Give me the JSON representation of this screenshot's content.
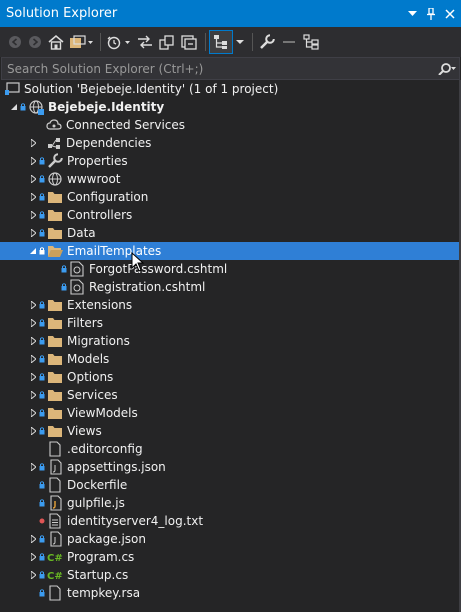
{
  "window": {
    "title": "Solution Explorer",
    "pin_icon": "pin-icon",
    "close_icon": "close-icon",
    "dropdown_icon": "dropdown-icon"
  },
  "search": {
    "placeholder": "Search Solution Explorer (Ctrl+;)",
    "value": ""
  },
  "colors": {
    "titlebar": "#007acc",
    "background": "#252526",
    "selection": "#2f7fd6",
    "folder": "#dcb67a",
    "lock": "#3c9cf0"
  },
  "tree": {
    "solution": "Solution 'Bejebeje.Identity' (1 of 1 project)",
    "project": "Bejebeje.Identity",
    "items": {
      "connected_services": "Connected Services",
      "dependencies": "Dependencies",
      "properties": "Properties",
      "wwwroot": "wwwroot",
      "configuration": "Configuration",
      "controllers": "Controllers",
      "data": "Data",
      "email_templates": "EmailTemplates",
      "forgot_password": "ForgotPassword.cshtml",
      "registration": "Registration.cshtml",
      "extensions": "Extensions",
      "filters": "Filters",
      "migrations": "Migrations",
      "models": "Models",
      "options": "Options",
      "services": "Services",
      "view_models": "ViewModels",
      "views": "Views",
      "editorconfig": ".editorconfig",
      "appsettings": "appsettings.json",
      "dockerfile": "Dockerfile",
      "gulpfile": "gulpfile.js",
      "log": "identityserver4_log.txt",
      "package": "package.json",
      "program": "Program.cs",
      "startup": "Startup.cs",
      "tempkey": "tempkey.rsa"
    }
  }
}
